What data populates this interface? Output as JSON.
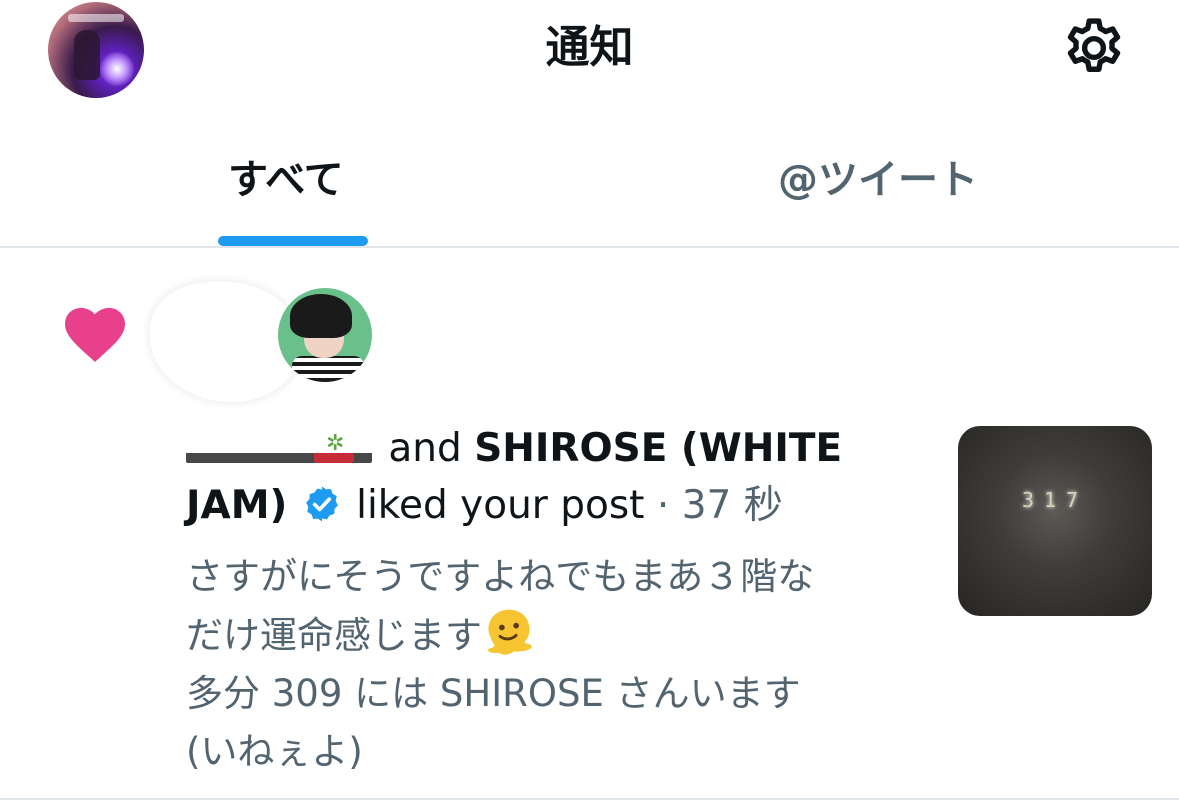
{
  "header": {
    "title": "通知",
    "settings_icon": "gear-icon"
  },
  "tabs": [
    {
      "label": "すべて",
      "selected": true
    },
    {
      "label": "@ツイート",
      "selected": false
    }
  ],
  "colors": {
    "accent": "#1d9bf0",
    "like": "#f91880",
    "verified": "#1d9bf0",
    "muted_text": "#536471"
  },
  "notification": {
    "type_icon": "heart-icon",
    "conjunction": "and",
    "actor": "SHIROSE (WHITE JAM)",
    "action": "liked your post",
    "separator": "·",
    "time": "37 秒",
    "post_lines": [
      "さすがにそうですよねでもまあ３階な",
      "だけ運命感じます",
      "多分 309 には SHIROSE さんいます",
      "(いねぇよ)"
    ],
    "emoji": "melting-face-emoji",
    "thumbnail_text": "317"
  }
}
